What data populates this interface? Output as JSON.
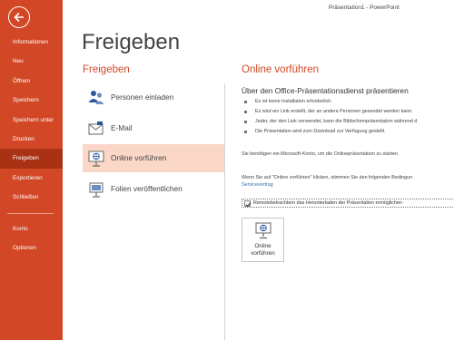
{
  "window": {
    "title": "Präsentation1 - PowerPoint"
  },
  "sidebar": {
    "items": [
      {
        "label": "Informationen"
      },
      {
        "label": "Neu"
      },
      {
        "label": "Öffnen"
      },
      {
        "label": "Speichern"
      },
      {
        "label": "Speichern unter"
      },
      {
        "label": "Drucken"
      },
      {
        "label": "Freigeben",
        "active": true
      },
      {
        "label": "Exportieren"
      },
      {
        "label": "Schließen"
      }
    ],
    "bottom_items": [
      {
        "label": "Konto"
      },
      {
        "label": "Optionen"
      }
    ],
    "back_icon": "back-arrow-icon"
  },
  "main": {
    "page_title": "Freigeben",
    "section_title": "Freigeben",
    "options": [
      {
        "label": "Personen einladen",
        "icon": "people-icon"
      },
      {
        "label": "E-Mail",
        "icon": "email-icon"
      },
      {
        "label": "Online vorführen",
        "icon": "present-online-icon",
        "active": true
      },
      {
        "label": "Folien veröffentlichen",
        "icon": "publish-slides-icon"
      }
    ]
  },
  "panel": {
    "title": "Online vorführen",
    "subheading": "Über den Office-Präsentationsdienst präsentieren",
    "bullets": [
      "Es ist keine Installation erforderlich.",
      "Es wird ein Link erstellt, der an andere Personen gesendet werden kann.",
      "Jeder, der den Link verwendet, kann die Bildschirmpräsentation während d",
      "Die Präsentation wird zum Download zur Verfügung gestellt."
    ],
    "account_note": "Sie benötigen ein Microsoft-Konto, um die Onlinepräsentation zu starten.",
    "terms_note": "Wenn Sie auf \"Online vorführen\" klicken, stimmen Sie den folgenden Bedingun",
    "terms_link": "Servicevertrag",
    "checkbox": {
      "label": "Remotebetrachtern das Herunterladen der Präsentation ermöglichen",
      "checked": true
    },
    "button_label": "Online\nvorführen"
  },
  "colors": {
    "accent": "#d24726",
    "active_nav": "#a93215",
    "active_option": "#fbd7c7",
    "link": "#2a6fb5"
  }
}
